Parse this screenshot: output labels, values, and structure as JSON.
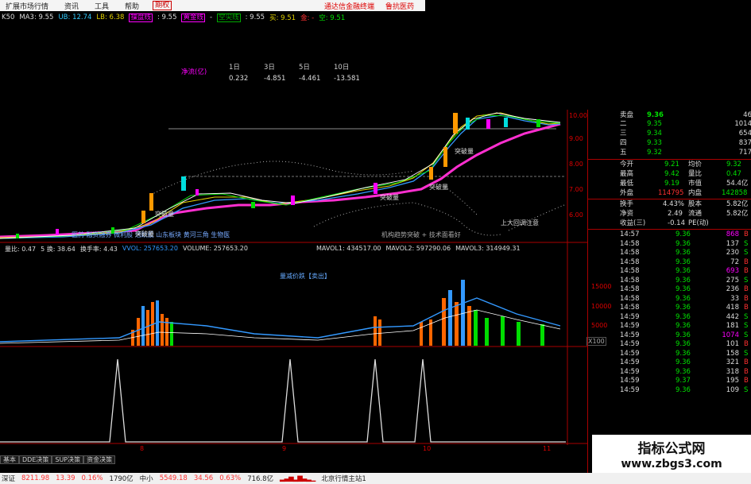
{
  "menu": {
    "tabs": [
      "扩展市场行情",
      "资讯",
      "工具",
      "帮助"
    ],
    "active_tab": "期权",
    "links": [
      "通达信金融终端",
      "鲁抗医药"
    ]
  },
  "indicator_bar": {
    "k50": "K50",
    "ma3": "MA3: 9.55",
    "ub": "UB: 12.74",
    "lb": "LB: 6.38",
    "tag1": "操盘线",
    "tag1_val": ": 9.55",
    "tag2": "黄金线",
    "tag2_val": "-",
    "tag3": "空尖线",
    "tag3_val": ": 9.55",
    "buy": "买: 9.51",
    "gold": "金: -",
    "empty": "空: 9.51"
  },
  "net_flow": {
    "label": "净流(亿)",
    "headers": [
      "1日",
      "3日",
      "5日",
      "10日"
    ],
    "values": [
      "0.232",
      "-4.851",
      "-4.461",
      "-13.581"
    ]
  },
  "chart_annotations": {
    "breakout": [
      "突破量",
      "突破量",
      "突破量",
      "突破量",
      "突破量"
    ],
    "concept_line": "医药 融资融券 微利股 活跃股 山东板块 黄河三角 生物医",
    "notes_line": "机构趋势突破 + 技术面看好",
    "bottom_note": "上大回调注意",
    "volume_label": "量减价跌【卖出】"
  },
  "volume_bar": {
    "amount": "量比: 0.47",
    "turn": "5 换: 38.64",
    "turnover": "换手率: 4.43",
    "vvol": "VVOL: 257653.20",
    "volume": "VOLUME: 257653.20",
    "mavol1": "MAVOL1: 434517.00",
    "mavol2": "MAVOL2: 597290.06",
    "mavol3": "MAVOL3: 314949.31"
  },
  "price_axis": [
    "10.00",
    "9.00",
    "8.00",
    "7.00",
    "6.00"
  ],
  "volume_axis": [
    "15000",
    "10000",
    "5000",
    "X100"
  ],
  "date_labels": [
    "8",
    "9",
    "10",
    "11"
  ],
  "order_book": [
    {
      "side": "卖盘",
      "level": "",
      "price": "9.36",
      "vol": "46"
    },
    {
      "side": "",
      "level": "二",
      "price": "9.35",
      "vol": "1014"
    },
    {
      "side": "",
      "level": "三",
      "price": "9.34",
      "vol": "654"
    },
    {
      "side": "",
      "level": "四",
      "price": "9.33",
      "vol": "837"
    },
    {
      "side": "",
      "level": "五",
      "price": "9.32",
      "vol": "717"
    }
  ],
  "stats": [
    {
      "k1": "今开",
      "v1": "9.21",
      "k2": "均价",
      "v2": "9.32"
    },
    {
      "k1": "最高",
      "v1": "9.42",
      "k2": "量比",
      "v2": "0.47"
    },
    {
      "k1": "最低",
      "v1": "9.19",
      "k2": "市值",
      "v2": "54.4亿"
    },
    {
      "k1": "外盘",
      "v1": "114795",
      "k2": "内盘",
      "v2": "142858"
    },
    {
      "k1": "换手",
      "v1": "4.43%",
      "k2": "股本",
      "v2": "5.82亿"
    },
    {
      "k1": "净资",
      "v1": "2.49",
      "k2": "流通",
      "v2": "5.82亿"
    },
    {
      "k1": "收益(三)",
      "v1": "-0.14",
      "k2": "PE(动)",
      "v2": ""
    }
  ],
  "ticks": [
    {
      "t": "14:57",
      "p": "9.36",
      "v": "868",
      "s": "B"
    },
    {
      "t": "14:58",
      "p": "9.36",
      "v": "137",
      "s": "S"
    },
    {
      "t": "14:58",
      "p": "9.36",
      "v": "230",
      "s": "S"
    },
    {
      "t": "14:58",
      "p": "9.36",
      "v": "72",
      "s": "B"
    },
    {
      "t": "14:58",
      "p": "9.36",
      "v": "693",
      "s": "B"
    },
    {
      "t": "14:58",
      "p": "9.36",
      "v": "275",
      "s": "S"
    },
    {
      "t": "14:58",
      "p": "9.36",
      "v": "236",
      "s": "B"
    },
    {
      "t": "14:58",
      "p": "9.36",
      "v": "33",
      "s": "B"
    },
    {
      "t": "14:58",
      "p": "9.36",
      "v": "418",
      "s": "B"
    },
    {
      "t": "14:59",
      "p": "9.36",
      "v": "442",
      "s": "S"
    },
    {
      "t": "14:59",
      "p": "9.36",
      "v": "181",
      "s": "S"
    },
    {
      "t": "14:59",
      "p": "9.36",
      "v": "1074",
      "s": "S"
    },
    {
      "t": "14:59",
      "p": "9.36",
      "v": "101",
      "s": "B"
    },
    {
      "t": "14:59",
      "p": "9.36",
      "v": "158",
      "s": "S"
    },
    {
      "t": "14:59",
      "p": "9.36",
      "v": "321",
      "s": "B"
    },
    {
      "t": "14:59",
      "p": "9.36",
      "v": "318",
      "s": "B"
    },
    {
      "t": "14:59",
      "p": "9.37",
      "v": "195",
      "s": "B"
    },
    {
      "t": "14:59",
      "p": "9.36",
      "v": "109",
      "s": "S"
    }
  ],
  "subtabs": [
    "基本",
    "DDE决策",
    "SUP决策",
    "资金决策"
  ],
  "bottom": {
    "index1_name": "深证",
    "index1_val": "8211.98",
    "index1_chg": "13.39",
    "index1_pct": "0.16%",
    "index1_amt": "1790亿",
    "index2_name": "中小",
    "index2_val": "5549.18",
    "index2_chg": "34.56",
    "index2_pct": "0.63%",
    "index2_amt": "716.8亿",
    "server": "北京行情主站1"
  },
  "watermark": {
    "title": "指标公式网",
    "url": "www.zbgs3.com"
  },
  "colors": {
    "up": "#ff3030",
    "down": "#00e000",
    "accent": "#f0f",
    "border": "#a00"
  }
}
